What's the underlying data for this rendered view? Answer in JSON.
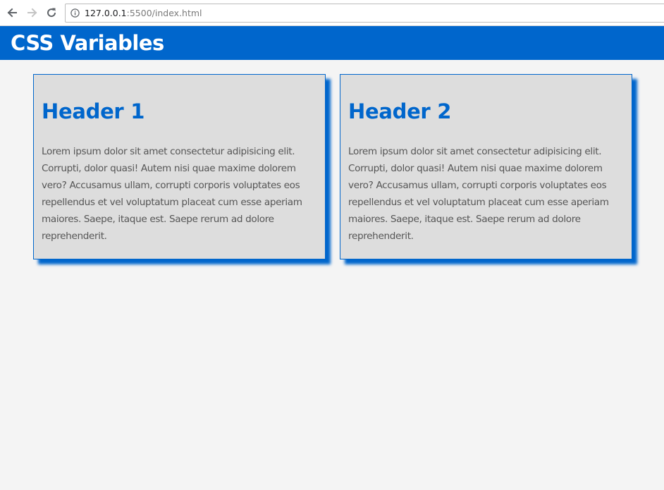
{
  "browser": {
    "url_host": "127.0.0.1",
    "url_rest": ":5500/index.html",
    "icons": {
      "back": "arrow-left-icon",
      "forward": "arrow-right-icon",
      "reload": "reload-icon",
      "info": "info-icon"
    }
  },
  "page": {
    "title": "CSS Variables",
    "colors": {
      "primary": "#0066cc",
      "background": "#f4f4f4",
      "card_background": "#dddddd",
      "text": "#555555",
      "header_text": "#ffffff"
    }
  },
  "cards": [
    {
      "title": "Header 1",
      "body": "Lorem ipsum dolor sit amet consectetur adipisicing elit. Corrupti, dolor quasi! Autem nisi quae maxime dolorem vero? Accusamus ullam, corrupti corporis voluptates eos repellendus et vel voluptatum placeat cum esse aperiam maiores. Saepe, itaque est. Saepe rerum ad dolore reprehenderit."
    },
    {
      "title": "Header 2",
      "body": "Lorem ipsum dolor sit amet consectetur adipisicing elit. Corrupti, dolor quasi! Autem nisi quae maxime dolorem vero? Accusamus ullam, corrupti corporis voluptates eos repellendus et vel voluptatum placeat cum esse aperiam maiores. Saepe, itaque est. Saepe rerum ad dolore reprehenderit."
    }
  ]
}
